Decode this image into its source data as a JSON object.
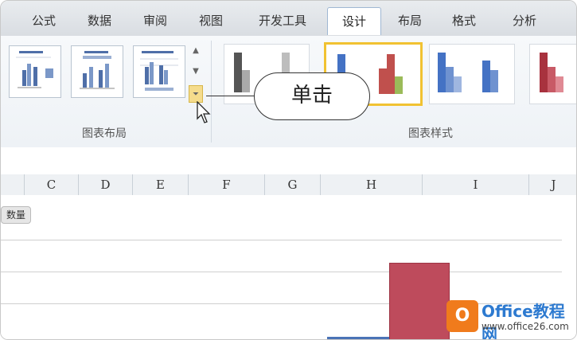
{
  "ribbon_tabs": [
    "公式",
    "数据",
    "审阅",
    "视图",
    "开发工具",
    "设计",
    "布局",
    "格式",
    "分析"
  ],
  "active_tab": "设计",
  "groups": {
    "layout_label": "图表布局",
    "style_label": "图表样式"
  },
  "callout": {
    "text": "单击"
  },
  "columns": [
    "C",
    "D",
    "E",
    "F",
    "G",
    "H",
    "I",
    "J"
  ],
  "sheet": {
    "label_tag": "数量"
  },
  "watermark": {
    "title": "Office教程网",
    "url": "www.office26.com"
  },
  "colors": {
    "accent_tab_border": "#9fb7d3",
    "selected_style": "#f1c232",
    "bar_red": "#be4b5c",
    "bar_blue": "#4a73b6",
    "logo_orange": "#f07b1c"
  }
}
